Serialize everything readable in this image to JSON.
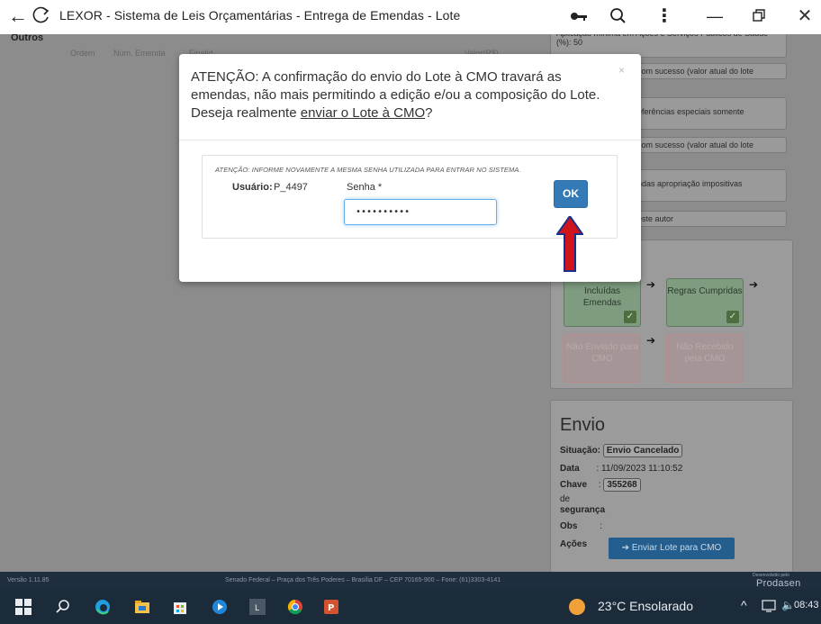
{
  "window": {
    "title": "LEXOR - Sistema de Leis Orçamentárias - Entrega de Emendas - Lote"
  },
  "page": {
    "section_title": "Outros",
    "table_headers": [
      "Ordem",
      "Núm. Emenda",
      "Finalid.",
      "Valor(R$)"
    ],
    "alerts": [
      "Aplicação mínima em Ações e Serviços Públicos de Saúde (%): 50",
      "com sucesso (valor atual do lote",
      "eferências especiais somente",
      "com sucesso (valor atual do lote",
      "ndas apropriação impositivas",
      "este autor"
    ],
    "flow": [
      {
        "label": "Incluídas Emendas",
        "state": "ok"
      },
      {
        "label": "Regras Cumpridas",
        "state": "ok"
      },
      {
        "label": "Não Enviado para CMO",
        "state": "pending"
      },
      {
        "label": "Não Recebido pela CMO",
        "state": "pending"
      }
    ],
    "envio": {
      "title": "Envio",
      "situacao_label": "Situação:",
      "situacao_value": "Envio Cancelado",
      "data_label": "Data",
      "data_value": ": 11/09/2023 11:10:52",
      "chave_label": "Chave",
      "chave_value": "355268",
      "de_label": "de",
      "seguranca_label": "segurança",
      "obs_label": "Obs",
      "obs_value": ":",
      "acoes_label": "Ações",
      "button_label": "➔ Enviar Lote para CMO"
    }
  },
  "modal": {
    "message_part1": "ATENÇÃO: A confirmação do envio do Lote à CMO travará as emendas, não mais permitindo a edição e/ou a composição do Lote. Deseja realmente ",
    "message_link": "enviar o Lote à CMO",
    "message_part2": "?",
    "close_glyph": "×",
    "note": "ATENÇÃO: INFORME NOVAMENTE A MESMA SENHA UTILIZADA PARA ENTRAR NO SISTEMA.",
    "user_label": "Usuário:",
    "user_value": "P_4497",
    "password_label": "Senha *",
    "password_value": "••••••••••",
    "ok_label": "OK"
  },
  "footer": {
    "version": "Versão 1.11.85",
    "address": "Senado Federal – Praça dos Três Poderes – Brasília DF – CEP 70165-900 – Fone: (61)3303-4141",
    "dev_by": "Desenvolvido pelo",
    "logo": "Prodasen"
  },
  "taskbar": {
    "weather": "23°C  Ensolarado",
    "time": "08:43"
  },
  "colors": {
    "primary_button": "#337ab7",
    "overlay_page": "#8c8c8c",
    "footer": "#1e2e3f",
    "taskbar": "#1c2b3a",
    "annotation_arrow": "#d0141c"
  }
}
